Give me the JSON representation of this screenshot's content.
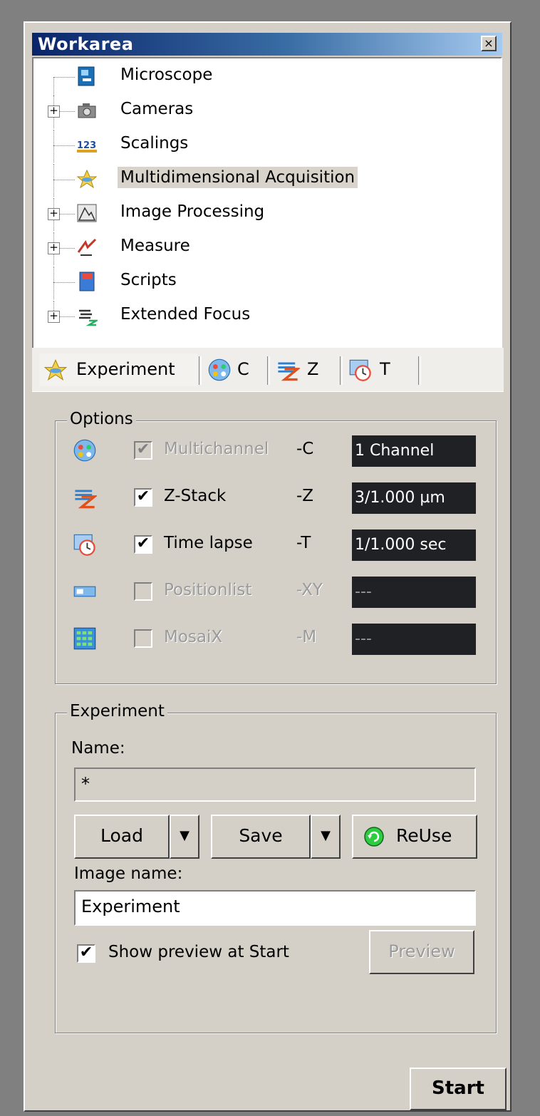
{
  "window": {
    "title": "Workarea",
    "close_glyph": "×"
  },
  "tree": {
    "items": [
      {
        "label": "Microscope",
        "icon": "microscope-icon",
        "expandable": false
      },
      {
        "label": "Cameras",
        "icon": "camera-icon",
        "expandable": true
      },
      {
        "label": "Scalings",
        "icon": "scalings-icon",
        "expandable": false
      },
      {
        "label": "Multidimensional Acquisition",
        "icon": "acquisition-icon",
        "expandable": false,
        "selected": true
      },
      {
        "label": "Image Processing",
        "icon": "image-processing-icon",
        "expandable": true
      },
      {
        "label": "Measure",
        "icon": "measure-icon",
        "expandable": true
      },
      {
        "label": "Scripts",
        "icon": "scripts-icon",
        "expandable": false
      },
      {
        "label": "Extended Focus",
        "icon": "extended-focus-icon",
        "expandable": true
      }
    ],
    "expander_glyph": "+"
  },
  "tabs": [
    {
      "label": "Experiment",
      "icon": "experiment-icon",
      "active": true
    },
    {
      "label": "C",
      "icon": "channel-icon",
      "active": false
    },
    {
      "label": "Z",
      "icon": "z-stack-icon",
      "active": false
    },
    {
      "label": "T",
      "icon": "time-lapse-icon",
      "active": false
    }
  ],
  "options": {
    "legend": "Options",
    "rows": [
      {
        "label": "Multichannel",
        "suffix": "-C",
        "value": "1 Channel",
        "checked": true,
        "enabled": false,
        "icon": "channel-icon"
      },
      {
        "label": "Z-Stack",
        "suffix": "-Z",
        "value": "3/1.000 µm",
        "checked": true,
        "enabled": true,
        "icon": "z-stack-icon"
      },
      {
        "label": "Time lapse",
        "suffix": "-T",
        "value": "1/1.000 sec",
        "checked": true,
        "enabled": true,
        "icon": "time-lapse-icon"
      },
      {
        "label": "Positionlist",
        "suffix": "-XY",
        "value": "---",
        "checked": false,
        "enabled": false,
        "icon": "position-list-icon"
      },
      {
        "label": "MosaiX",
        "suffix": "-M",
        "value": "---",
        "checked": false,
        "enabled": false,
        "icon": "mosaix-icon"
      }
    ],
    "check_glyph": "✔"
  },
  "experiment": {
    "legend": "Experiment",
    "name_label": "Name:",
    "name_value": "*",
    "load_label": "Load",
    "save_label": "Save",
    "reuse_label": "ReUse",
    "dropdown_glyph": "▼",
    "image_name_label": "Image name:",
    "image_name_value": "Experiment",
    "show_preview_label": "Show preview at Start",
    "show_preview_checked": true,
    "preview_label": "Preview"
  },
  "start_label": "Start",
  "colors": {
    "title_start": "#0a246a",
    "title_end": "#a6caf0",
    "face": "#d4d0c8",
    "value_bg": "#202124"
  }
}
